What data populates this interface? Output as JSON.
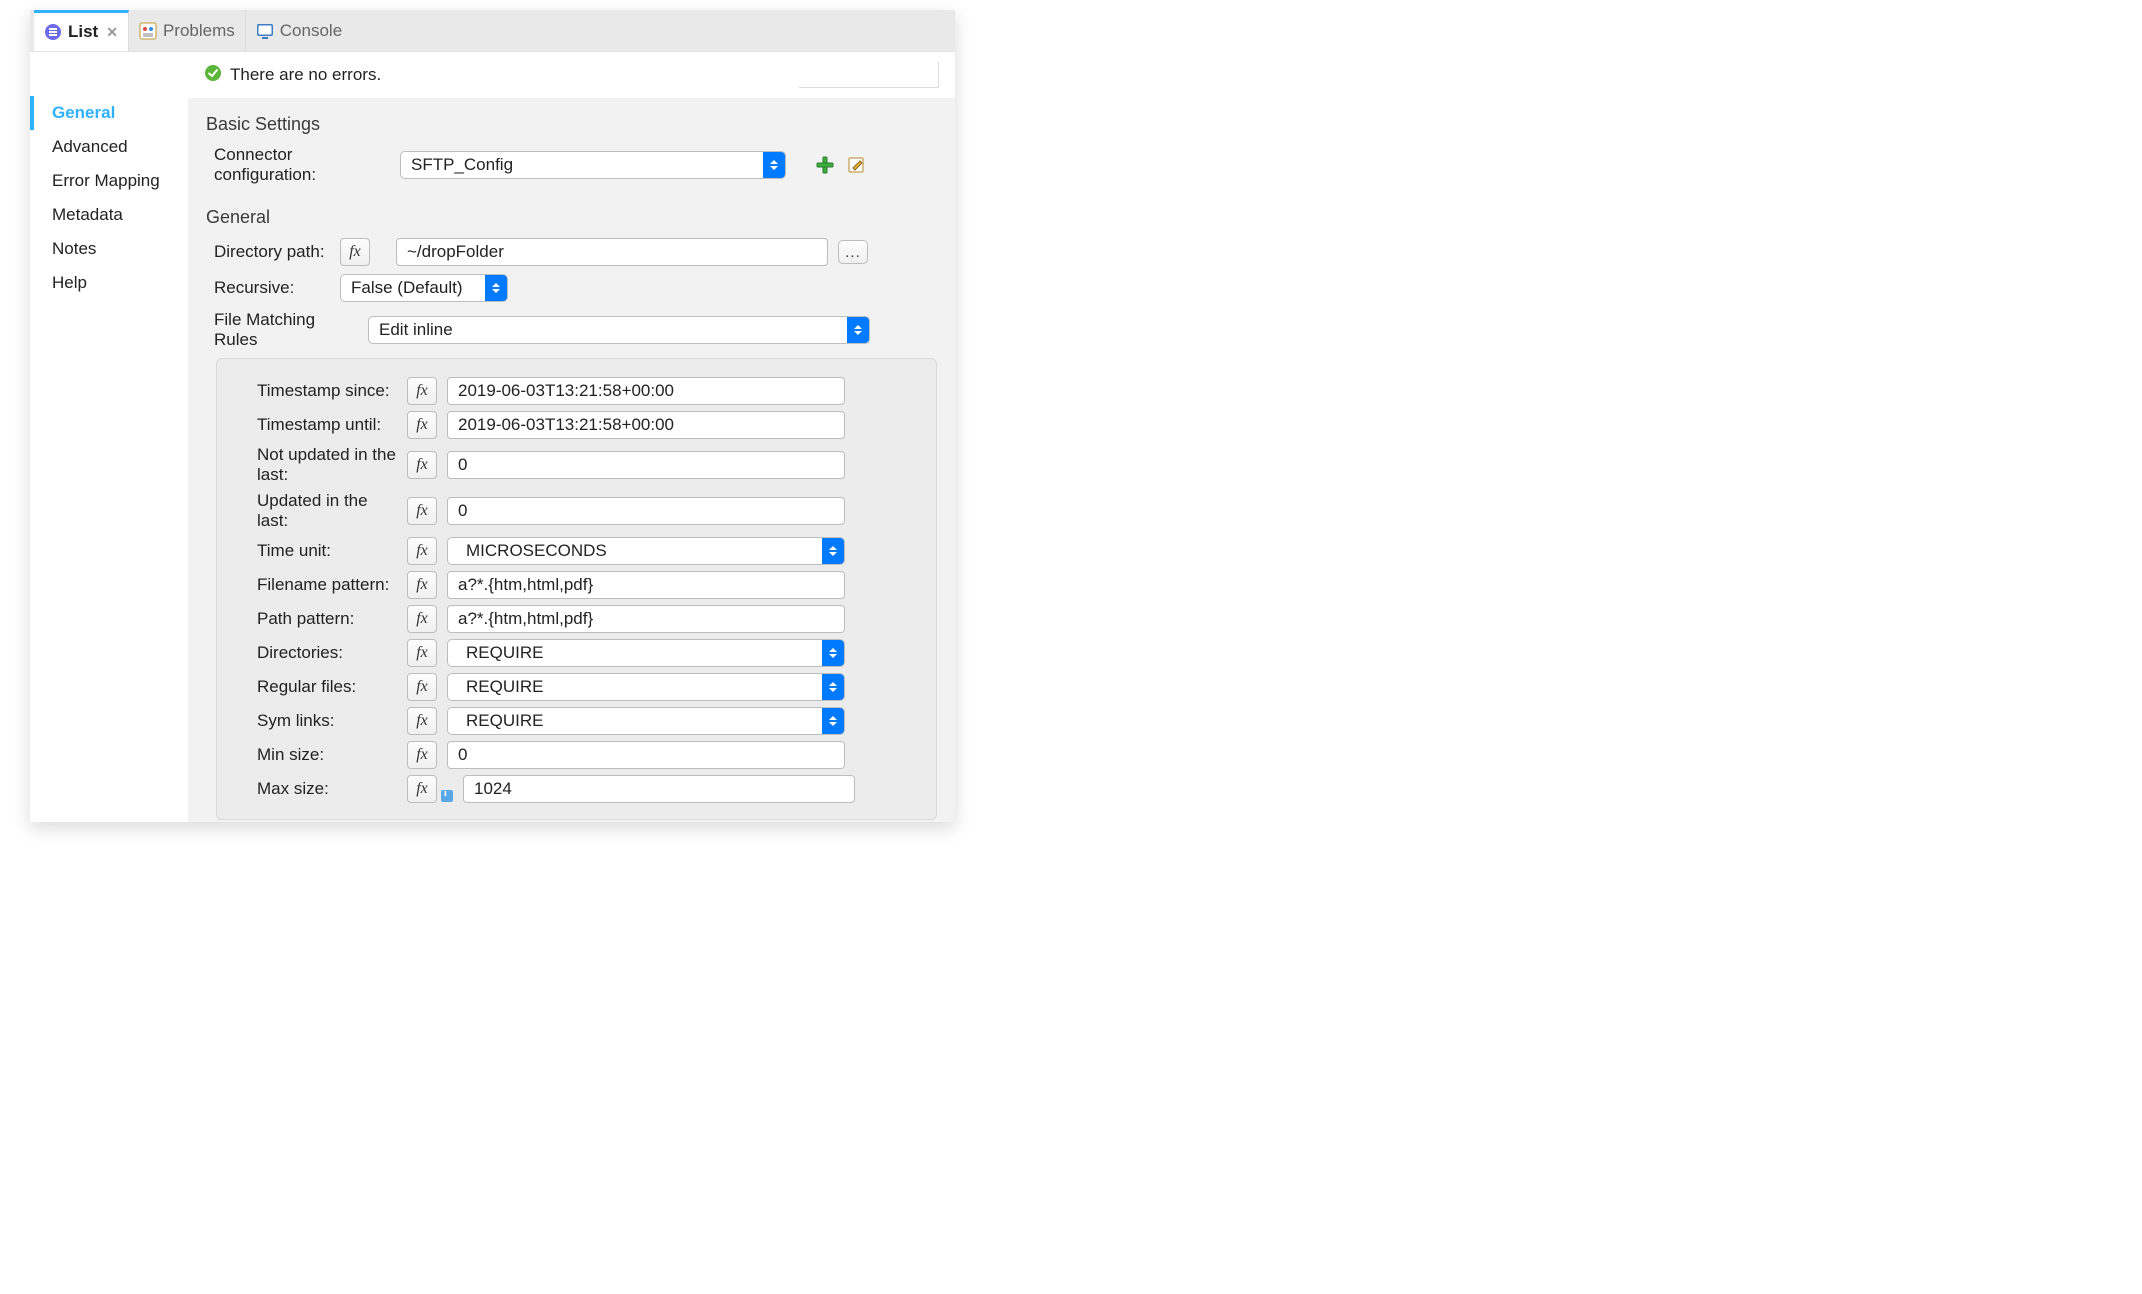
{
  "tabs": {
    "list": {
      "label": "List"
    },
    "problems": {
      "label": "Problems"
    },
    "console": {
      "label": "Console"
    }
  },
  "sidebar": [
    {
      "id": "general",
      "label": "General",
      "selected": true
    },
    {
      "id": "advanced",
      "label": "Advanced"
    },
    {
      "id": "error-mapping",
      "label": "Error Mapping"
    },
    {
      "id": "metadata",
      "label": "Metadata"
    },
    {
      "id": "notes",
      "label": "Notes"
    },
    {
      "id": "help",
      "label": "Help"
    }
  ],
  "status": {
    "text": "There are no errors."
  },
  "sections": {
    "basic_heading": "Basic Settings",
    "general_heading": "General"
  },
  "basic": {
    "connector_label": "Connector configuration:",
    "connector_value": "SFTP_Config"
  },
  "general": {
    "directory_label": "Directory path:",
    "directory_value": "~/dropFolder",
    "recursive_label": "Recursive:",
    "recursive_value": "False (Default)",
    "file_matching_label": "File Matching Rules",
    "file_matching_value": "Edit inline"
  },
  "rules": {
    "timestamp_since": {
      "label": "Timestamp since:",
      "value": "2019-06-03T13:21:58+00:00"
    },
    "timestamp_until": {
      "label": "Timestamp until:",
      "value": "2019-06-03T13:21:58+00:00"
    },
    "not_updated": {
      "label": "Not updated in the last:",
      "value": "0"
    },
    "updated": {
      "label": "Updated in the last:",
      "value": "0"
    },
    "time_unit": {
      "label": "Time unit:",
      "value": "MICROSECONDS"
    },
    "filename": {
      "label": "Filename pattern:",
      "value": "a?*.{htm,html,pdf}"
    },
    "path": {
      "label": "Path pattern:",
      "value": "a?*.{htm,html,pdf}"
    },
    "directories": {
      "label": "Directories:",
      "value": "REQUIRE"
    },
    "regular": {
      "label": "Regular files:",
      "value": "REQUIRE"
    },
    "symlinks": {
      "label": "Sym links:",
      "value": "REQUIRE"
    },
    "min_size": {
      "label": "Min size:",
      "value": "0"
    },
    "max_size": {
      "label": "Max size:",
      "value": "1024"
    }
  }
}
